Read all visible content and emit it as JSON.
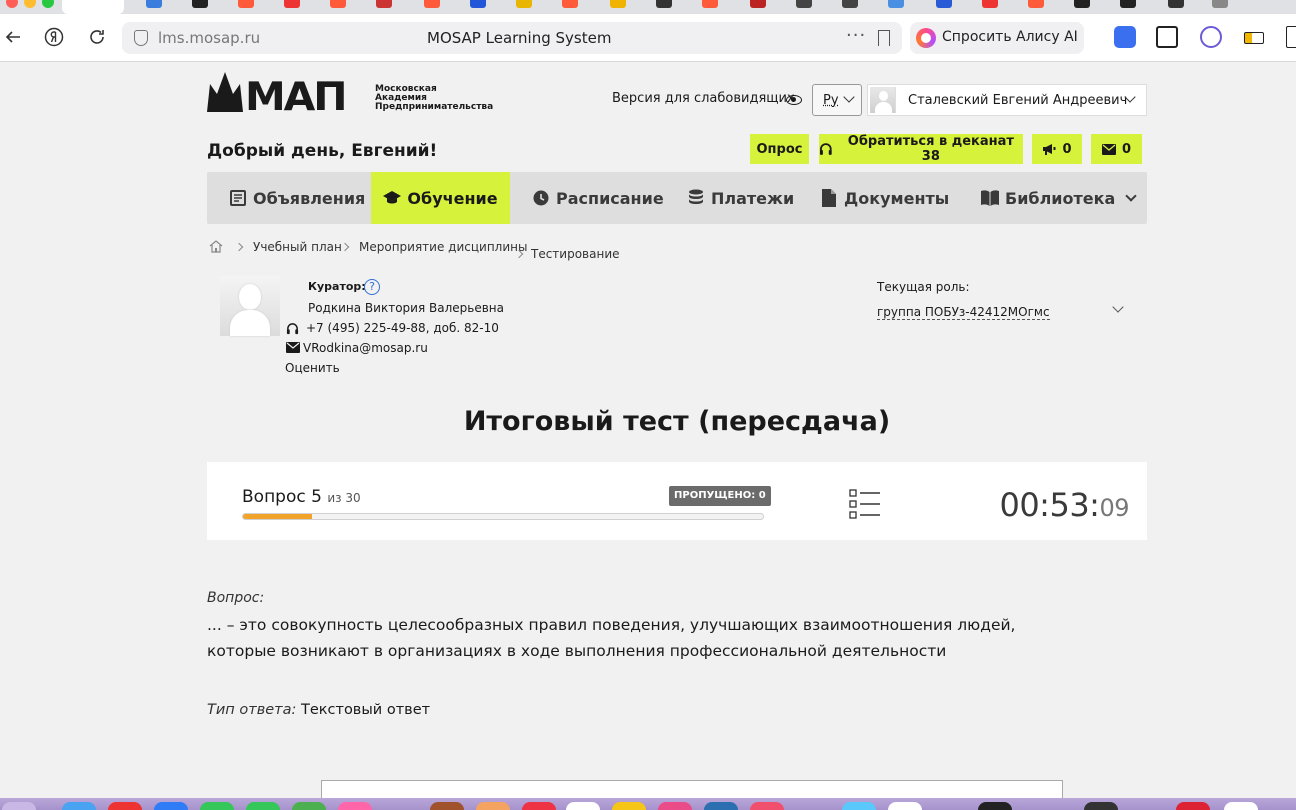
{
  "browser": {
    "url": "lms.mosap.ru",
    "page_title": "MOSAP Learning System",
    "alisa_label": "Спросить Алису AI"
  },
  "header": {
    "logo_text": "МАП",
    "logo_sub_line1": "Московская",
    "logo_sub_line2": "Академия",
    "logo_sub_line3": "Предпринимательства",
    "vision_label": "Версия для слабовидящих",
    "language": "Ру",
    "user_name": "Сталевский Евгений Андреевич",
    "greeting": "Добрый день, Евгений!"
  },
  "actions": {
    "survey": "Опрос",
    "dean": "Обратиться в деканат 38",
    "notifications_count": "0",
    "messages_count": "0"
  },
  "nav": {
    "announcements": "Объявления",
    "learning": "Обучение",
    "schedule": "Расписание",
    "payments": "Платежи",
    "documents": "Документы",
    "library": "Библиотека"
  },
  "breadcrumbs": {
    "plan": "Учебный план",
    "event": "Мероприятие дисциплины",
    "testing": "Тестирование"
  },
  "curator": {
    "label": "Куратор:",
    "help": "?",
    "name": "Родкина Виктория Валерьевна",
    "phone": "+7 (495) 225-49-88, доб. 82-10",
    "email": "VRodkina@mosap.ru",
    "rate": "Оценить"
  },
  "role": {
    "label": "Текущая роль:",
    "value": "группа ПОБУз-42412МОгмс"
  },
  "test": {
    "title": "Итоговый тест (пересдача)",
    "question_label": "Вопрос",
    "question_number": "5",
    "of_total": "из 30",
    "skipped": "ПРОПУЩЕНО: 0",
    "progress_fraction": 0.1333,
    "timer_main": "00:53:",
    "timer_sec": "09"
  },
  "question": {
    "label": "Вопрос:",
    "text": "... – это совокупность целесообразных правил поведения, улучшающих взаимоотношения людей, которые возникают в организациях в ходе выполнения профессиональной деятельности",
    "answer_type_label": "Тип ответа:",
    "answer_type": "Текстовый ответ"
  },
  "colors": {
    "accent": "#d6f23a",
    "progress": "#f2a42a",
    "badge": "#6b6b6b"
  }
}
